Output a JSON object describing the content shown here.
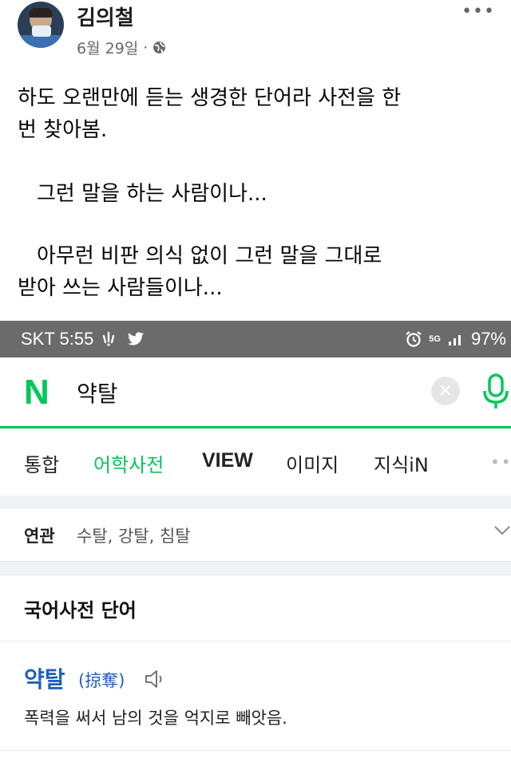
{
  "post": {
    "author": "김의철",
    "date": "6월 29일",
    "privacy_separator": "·",
    "privacy_icon": "globe-icon",
    "more_label": "•••",
    "paragraphs": [
      [
        "하도 오랜만에 듣는 생경한 단어라 사전을 한",
        "번 찾아봄."
      ],
      [
        "그런 말을 하는 사람이나..."
      ],
      [
        "아무런 비판 의식 없이 그런 말을 그대로",
        "받아 쓰는 사람들이나..."
      ]
    ]
  },
  "status_bar": {
    "carrier_time": "SKT 5:55",
    "network": "5G",
    "battery": "97%",
    "icons": [
      "notification-icon",
      "twitter-icon",
      "alarm-icon",
      "signal-icon"
    ]
  },
  "search": {
    "logo": "N",
    "query": "약탈",
    "clear_label": "×",
    "mic_icon": "mic-icon"
  },
  "tabs": [
    {
      "label": "통합",
      "active": false
    },
    {
      "label": "어학사전",
      "active": true
    },
    {
      "label": "VIEW",
      "active": false
    },
    {
      "label": "이미지",
      "active": false
    },
    {
      "label": "지식iN",
      "active": false
    }
  ],
  "related": {
    "label": "연관",
    "terms": "수탈, 강탈, 침탈"
  },
  "dictionary": {
    "section_title": "국어사전 단어",
    "word": "약탈",
    "hanja": "(掠奪)",
    "definition": "폭력을 써서 남의 것을 억지로 빼앗음."
  },
  "colors": {
    "naver_green": "#03c75a",
    "link_blue": "#1f5fbf",
    "status_bar": "#6b6b6b"
  }
}
